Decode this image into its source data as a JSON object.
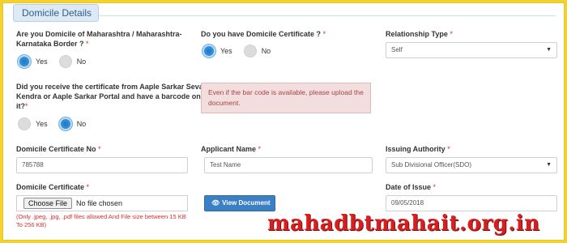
{
  "section": {
    "title": "Domicile Details"
  },
  "q_border": {
    "label_line1": "Are you Domicile of Maharashtra / Maharashtra-",
    "label_line2": "Karnataka Border ?",
    "required": "*",
    "options": [
      {
        "label": "Yes",
        "selected": true
      },
      {
        "label": "No",
        "selected": false
      }
    ]
  },
  "q_certificate": {
    "label": "Do you have Domicile Certificate ?",
    "required": "*",
    "options": [
      {
        "label": "Yes",
        "selected": true
      },
      {
        "label": "No",
        "selected": false
      }
    ]
  },
  "relationship": {
    "label": "Relationship Type",
    "required": "*",
    "value": "Self"
  },
  "q_barcode": {
    "label_line1": "Did you receive the certificate from Aaple Sarkar Seva",
    "label_line2": "Kendra or Aaple Sarkar Portal and have a barcode on",
    "label_line3": "it?",
    "required": "*",
    "options": [
      {
        "label": "Yes",
        "selected": false
      },
      {
        "label": "No",
        "selected": true
      }
    ]
  },
  "alert": {
    "line1": "Even if the bar code is available, please upload the",
    "line2": "document."
  },
  "cert_no": {
    "label": "Domicile Certificate No",
    "required": "*",
    "value": "785788"
  },
  "applicant": {
    "label": "Applicant Name",
    "required": "*",
    "value": "Test Name"
  },
  "authority": {
    "label": "Issuing Authority",
    "required": "*",
    "value": "Sub Divisional Officer(SDO)"
  },
  "cert_file": {
    "label": "Domicile Certificate",
    "required": "*",
    "button_label": "Choose File",
    "status": "No file chosen",
    "hint": "(Only .jpeg, .jpg, .pdf files allowed And File size between 15 KB To 256 KB)"
  },
  "view_document": {
    "label": "View Document",
    "icon": "eye-icon"
  },
  "issue_date": {
    "label": "Date of Issue",
    "required": "*",
    "value": "09/05/2018"
  },
  "watermark": {
    "text": "mahadbtmahait.org.in"
  },
  "colors": {
    "accent": "#2d8ed9",
    "required": "#d9302f",
    "button": "#3b7fc4",
    "border_yellow": "#f3d22e"
  }
}
